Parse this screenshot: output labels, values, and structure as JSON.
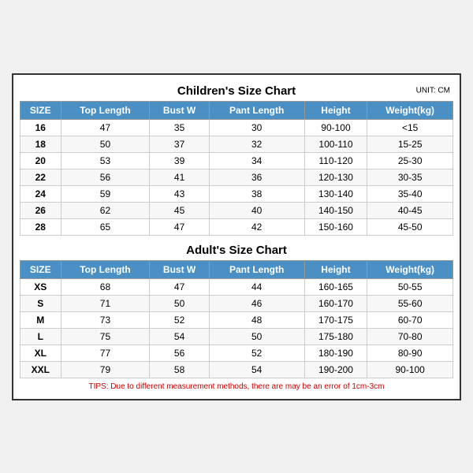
{
  "children_title": "Children's Size Chart",
  "adult_title": "Adult's Size Chart",
  "unit_label": "UNIT: CM",
  "headers": [
    "SIZE",
    "Top Length",
    "Bust W",
    "Pant Length",
    "Height",
    "Weight(kg)"
  ],
  "children_rows": [
    [
      "16",
      "47",
      "35",
      "30",
      "90-100",
      "<15"
    ],
    [
      "18",
      "50",
      "37",
      "32",
      "100-110",
      "15-25"
    ],
    [
      "20",
      "53",
      "39",
      "34",
      "110-120",
      "25-30"
    ],
    [
      "22",
      "56",
      "41",
      "36",
      "120-130",
      "30-35"
    ],
    [
      "24",
      "59",
      "43",
      "38",
      "130-140",
      "35-40"
    ],
    [
      "26",
      "62",
      "45",
      "40",
      "140-150",
      "40-45"
    ],
    [
      "28",
      "65",
      "47",
      "42",
      "150-160",
      "45-50"
    ]
  ],
  "adult_rows": [
    [
      "XS",
      "68",
      "47",
      "44",
      "160-165",
      "50-55"
    ],
    [
      "S",
      "71",
      "50",
      "46",
      "160-170",
      "55-60"
    ],
    [
      "M",
      "73",
      "52",
      "48",
      "170-175",
      "60-70"
    ],
    [
      "L",
      "75",
      "54",
      "50",
      "175-180",
      "70-80"
    ],
    [
      "XL",
      "77",
      "56",
      "52",
      "180-190",
      "80-90"
    ],
    [
      "XXL",
      "79",
      "58",
      "54",
      "190-200",
      "90-100"
    ]
  ],
  "tips": "TIPS: Due to different measurement methods, there are may be an error of 1cm-3cm"
}
